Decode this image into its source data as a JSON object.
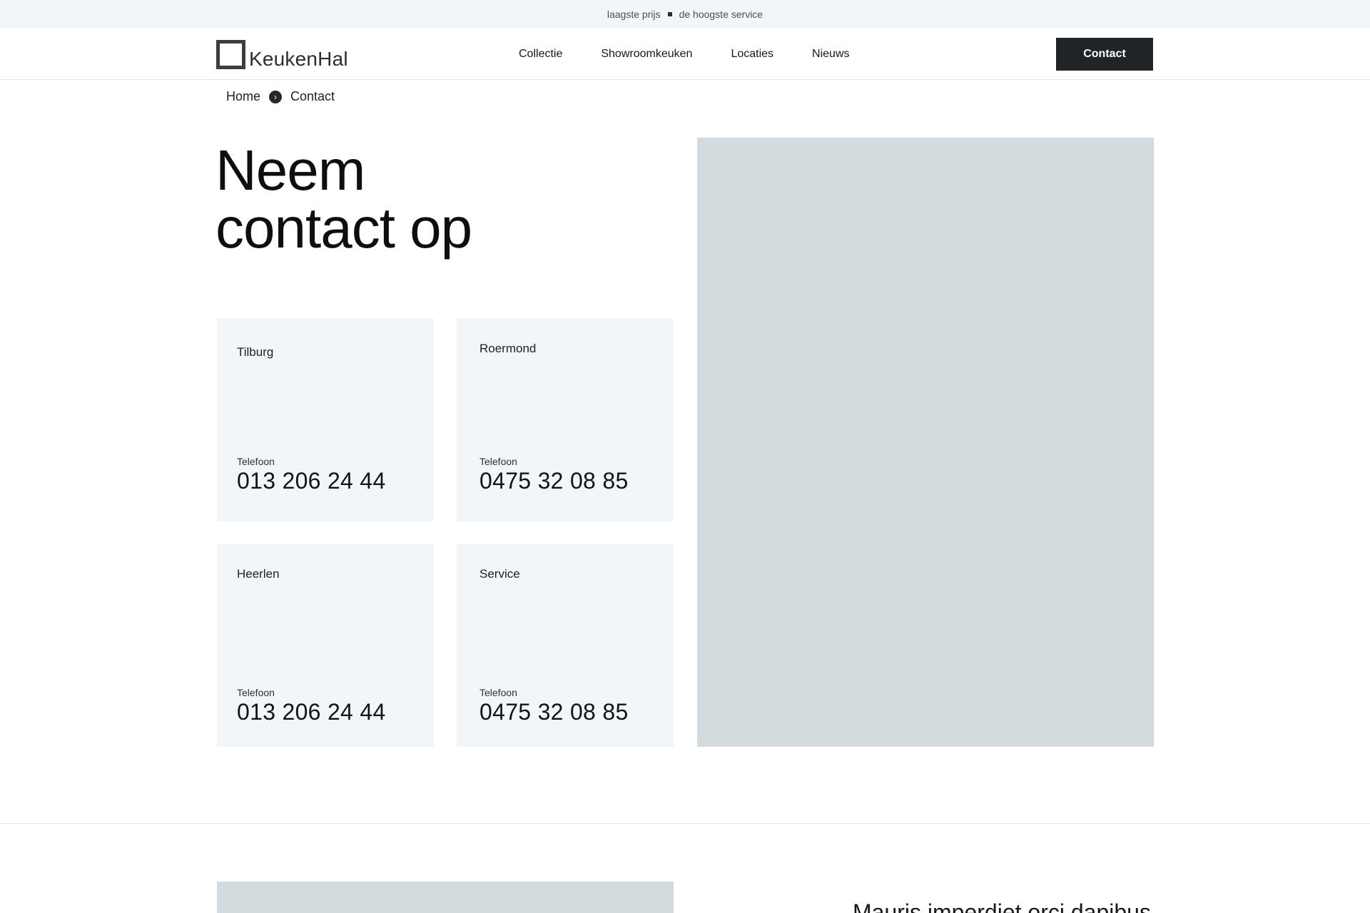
{
  "topbar": {
    "left_text": "laagste prijs",
    "right_text": "de hoogste service"
  },
  "header": {
    "logo_text": "KeukenHal",
    "nav": [
      "Collectie",
      "Showroomkeuken",
      "Locaties",
      "Nieuws"
    ],
    "contact_button": "Contact"
  },
  "breadcrumb": {
    "home": "Home",
    "current": "Contact"
  },
  "hero": {
    "title_line1": "Neem",
    "title_line2": "contact op"
  },
  "locations": [
    {
      "name": "Tilburg",
      "phone_label": "Telefoon",
      "phone": "013 206 24 44"
    },
    {
      "name": "Roermond",
      "phone_label": "Telefoon",
      "phone": "0475 32 08 85"
    },
    {
      "name": "Heerlen",
      "phone_label": "Telefoon",
      "phone": "013 206 24 44"
    },
    {
      "name": "Service",
      "phone_label": "Telefoon",
      "phone": "0475 32 08 85"
    }
  ],
  "bottom_section": {
    "heading": "Mauris imperdiet orci dapibus"
  },
  "colors": {
    "topbar_bg": "#f3f6f8",
    "card_bg": "#f3f6f9",
    "image_placeholder": "#d4dbdf",
    "button_bg": "#202427"
  }
}
